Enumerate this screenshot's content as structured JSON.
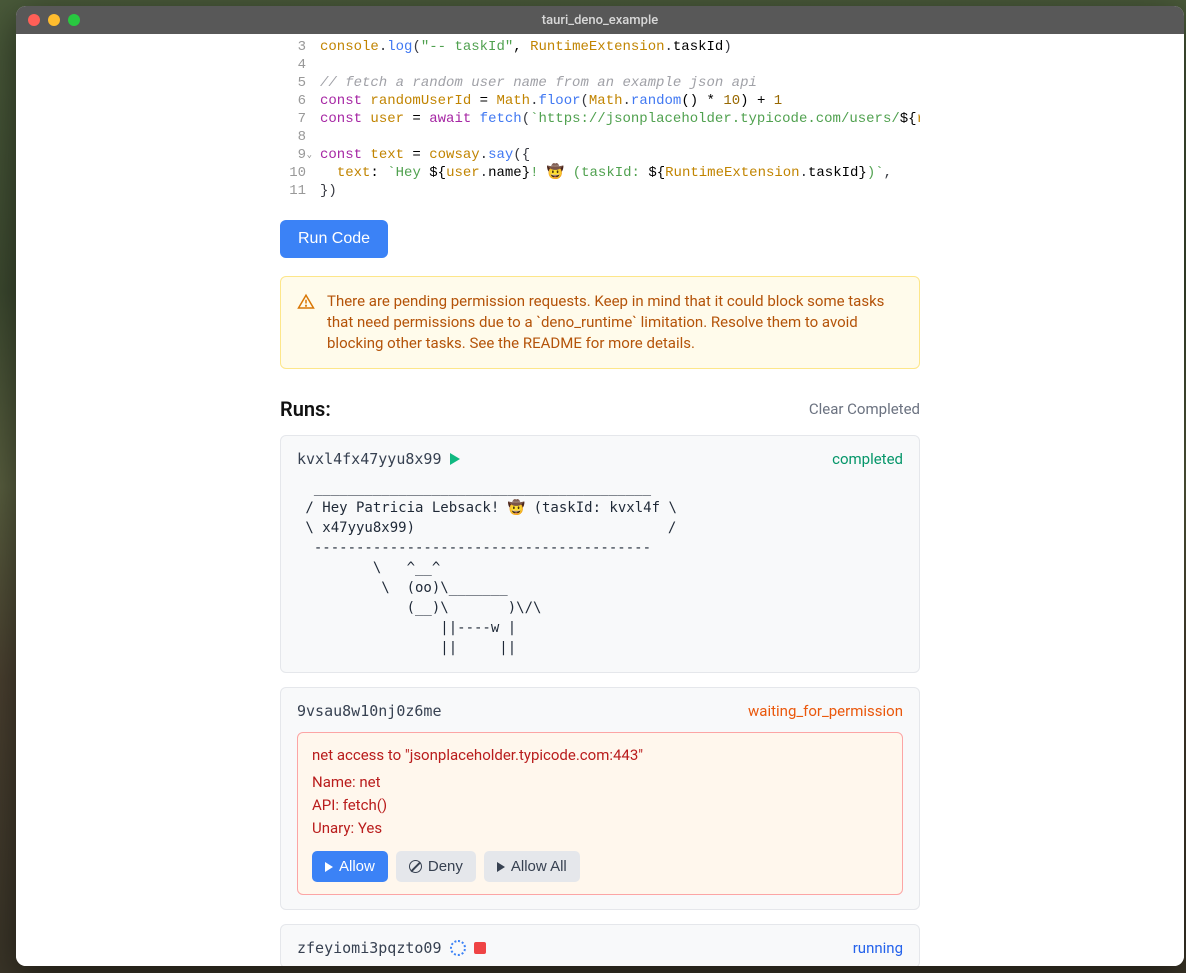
{
  "window": {
    "title": "tauri_deno_example"
  },
  "editor": {
    "lines": [
      {
        "n": 3,
        "tokens": [
          {
            "t": "console",
            "c": "var"
          },
          {
            "t": ".",
            "c": "punct"
          },
          {
            "t": "log",
            "c": "method"
          },
          {
            "t": "(",
            "c": "punct"
          },
          {
            "t": "\"-- taskId\"",
            "c": "str"
          },
          {
            "t": ", ",
            "c": "default"
          },
          {
            "t": "RuntimeExtension",
            "c": "var"
          },
          {
            "t": ".",
            "c": "punct"
          },
          {
            "t": "taskId",
            "c": "default"
          },
          {
            "t": ")",
            "c": "punct"
          }
        ]
      },
      {
        "n": 4,
        "tokens": []
      },
      {
        "n": 5,
        "tokens": [
          {
            "t": "// fetch a random user name from an example json api",
            "c": "comment"
          }
        ]
      },
      {
        "n": 6,
        "tokens": [
          {
            "t": "const ",
            "c": "kw"
          },
          {
            "t": "randomUserId",
            "c": "var"
          },
          {
            "t": " = ",
            "c": "default"
          },
          {
            "t": "Math",
            "c": "var"
          },
          {
            "t": ".",
            "c": "punct"
          },
          {
            "t": "floor",
            "c": "method"
          },
          {
            "t": "(",
            "c": "punct"
          },
          {
            "t": "Math",
            "c": "var"
          },
          {
            "t": ".",
            "c": "punct"
          },
          {
            "t": "random",
            "c": "method"
          },
          {
            "t": "() * ",
            "c": "default"
          },
          {
            "t": "10",
            "c": "num"
          },
          {
            "t": ") + ",
            "c": "default"
          },
          {
            "t": "1",
            "c": "num"
          }
        ]
      },
      {
        "n": 7,
        "tokens": [
          {
            "t": "const ",
            "c": "kw"
          },
          {
            "t": "user",
            "c": "var"
          },
          {
            "t": " = ",
            "c": "default"
          },
          {
            "t": "await ",
            "c": "kw"
          },
          {
            "t": "fetch",
            "c": "method"
          },
          {
            "t": "(",
            "c": "punct"
          },
          {
            "t": "`https://jsonplaceholder.typicode.com/users/",
            "c": "str"
          },
          {
            "t": "${",
            "c": "default"
          },
          {
            "t": "random",
            "c": "var"
          }
        ]
      },
      {
        "n": 8,
        "tokens": []
      },
      {
        "n": 9,
        "fold": true,
        "tokens": [
          {
            "t": "const ",
            "c": "kw"
          },
          {
            "t": "text",
            "c": "var"
          },
          {
            "t": " = ",
            "c": "default"
          },
          {
            "t": "cowsay",
            "c": "var"
          },
          {
            "t": ".",
            "c": "punct"
          },
          {
            "t": "say",
            "c": "method"
          },
          {
            "t": "({",
            "c": "punct"
          }
        ]
      },
      {
        "n": 10,
        "tokens": [
          {
            "t": "  ",
            "c": "default"
          },
          {
            "t": "text",
            "c": "var"
          },
          {
            "t": ": ",
            "c": "default"
          },
          {
            "t": "`Hey ",
            "c": "str"
          },
          {
            "t": "${",
            "c": "default"
          },
          {
            "t": "user",
            "c": "var"
          },
          {
            "t": ".",
            "c": "punct"
          },
          {
            "t": "name",
            "c": "default"
          },
          {
            "t": "}",
            "c": "default"
          },
          {
            "t": "! 🤠 (taskId: ",
            "c": "str"
          },
          {
            "t": "${",
            "c": "default"
          },
          {
            "t": "RuntimeExtension",
            "c": "var"
          },
          {
            "t": ".",
            "c": "punct"
          },
          {
            "t": "taskId",
            "c": "default"
          },
          {
            "t": "}",
            "c": "default"
          },
          {
            "t": ")`",
            "c": "str"
          },
          {
            "t": ",",
            "c": "punct"
          }
        ]
      },
      {
        "n": 11,
        "tokens": [
          {
            "t": "})",
            "c": "punct"
          }
        ]
      }
    ]
  },
  "run_button": "Run Code",
  "alert": {
    "text": "There are pending permission requests. Keep in mind that it could block some tasks that need permissions due to a `deno_runtime` limitation. Resolve them to avoid blocking other tasks. See the README for more details."
  },
  "runs": {
    "title": "Runs:",
    "clear": "Clear Completed",
    "items": [
      {
        "id": "kvxl4fx47yyu8x99",
        "status": "completed",
        "status_class": "status-completed",
        "icon": "play",
        "output": "  ________________________________________\n / Hey Patricia Lebsack! 🤠 (taskId: kvxl4f \\\n \\ x47yyu8x99)                              /\n  ----------------------------------------\n         \\   ^__^\n          \\  (oo)\\_______\n             (__)\\       )\\/\\\n                 ||----w |\n                 ||     ||"
      },
      {
        "id": "9vsau8w10nj0z6me",
        "status": "waiting_for_permission",
        "status_class": "status-waiting",
        "permission": {
          "title": "net access to \"jsonplaceholder.typicode.com:443\"",
          "name": "net",
          "api": "fetch()",
          "unary": "Yes",
          "allow": "Allow",
          "deny": "Deny",
          "allow_all": "Allow All"
        }
      },
      {
        "id": "zfeyiomi3pqzto09",
        "status": "running",
        "status_class": "status-running",
        "icon": "spinner-stop"
      }
    ]
  },
  "labels": {
    "perm_name": "Name: ",
    "perm_api": "API: ",
    "perm_unary": "Unary: "
  }
}
